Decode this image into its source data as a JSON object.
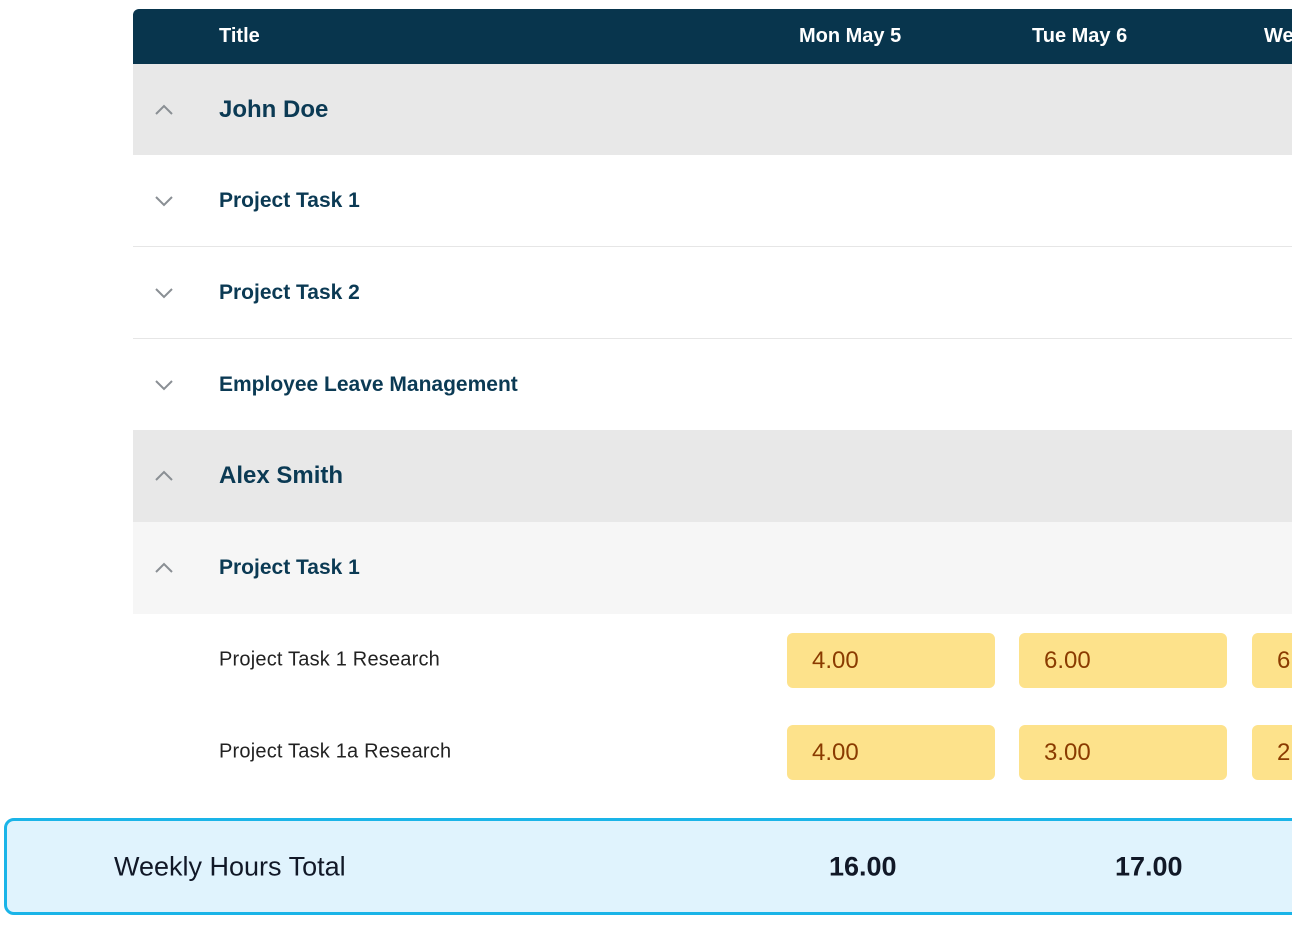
{
  "header": {
    "title_col": "Title",
    "days": [
      "Mon May 5",
      "Tue May 6",
      "We"
    ]
  },
  "rows": {
    "john": {
      "name": "John Doe",
      "expanded": true
    },
    "john_task1": {
      "label": "Project Task 1",
      "expanded": false
    },
    "john_task2": {
      "label": "Project Task 2",
      "expanded": false
    },
    "john_leave": {
      "label": "Employee Leave Management",
      "expanded": false
    },
    "alex": {
      "name": "Alex Smith",
      "expanded": true
    },
    "alex_task1": {
      "label": "Project Task 1",
      "expanded": true
    },
    "research": {
      "label": "Project Task 1 Research",
      "hours": [
        "4.00",
        "6.00",
        "6"
      ]
    },
    "research_a": {
      "label": "Project Task 1a Research",
      "hours": [
        "4.00",
        "3.00",
        "2"
      ]
    }
  },
  "totals": {
    "label": "Weekly Hours Total",
    "values": [
      "16.00",
      "17.00"
    ]
  },
  "colors": {
    "header_bg": "#08354d",
    "group_bg": "#e8e8e8",
    "hour_cell_bg": "#fde28b",
    "hour_text": "#8a3b00",
    "total_bg": "#e0f3fd",
    "total_border": "#1ab4e8"
  },
  "icons": {
    "expanded": "chevron-up-icon",
    "collapsed": "chevron-down-icon"
  }
}
